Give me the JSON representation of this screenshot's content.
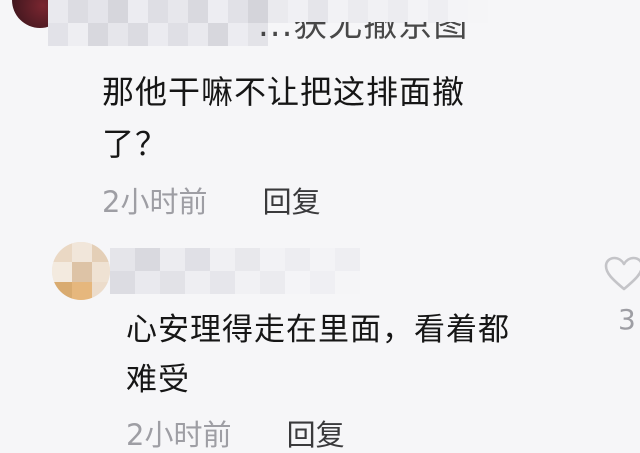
{
  "colors": {
    "background": "#f6f6f8",
    "primary_text": "#161616",
    "secondary_text": "#9e9ea4",
    "reply_text": "#3a3a3c",
    "heart_outline": "#c4c4c8"
  },
  "comments": [
    {
      "username_partial": "...获尤撤京图",
      "text_lines": [
        "那他干嘛不让把这排面撤",
        "了？"
      ],
      "time": "2小时前",
      "reply_label": "回复"
    },
    {
      "text_lines": [
        "心安理得走在里面，看着都",
        "难受"
      ],
      "time": "2小时前",
      "reply_label": "回复",
      "like_icon": "heart-outline-icon",
      "like_count": "3"
    }
  ]
}
